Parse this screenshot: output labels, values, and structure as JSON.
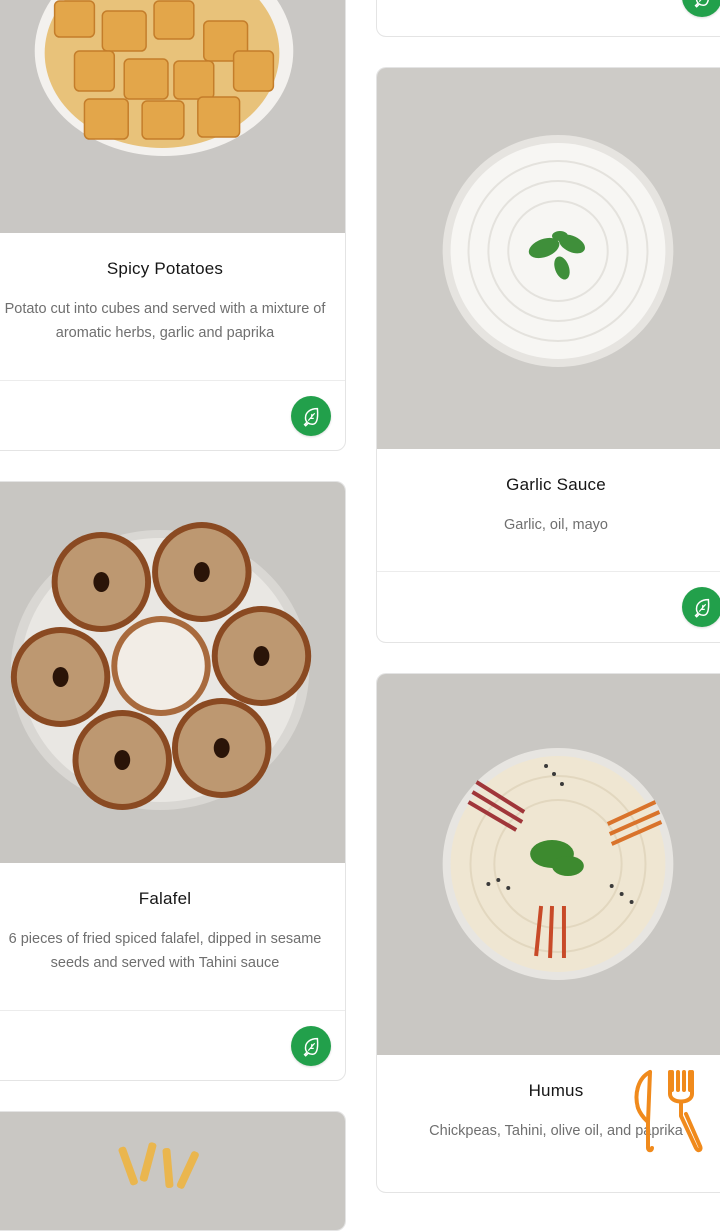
{
  "items": [
    {
      "title": "Spicy Potatoes",
      "description": "Potato cut into cubes and served with a mixture of aromatic herbs, garlic and paprika"
    },
    {
      "title": "Garlic Sauce",
      "description": "Garlic, oil, mayo"
    },
    {
      "title": "Falafel",
      "description": "6 pieces of fried spiced falafel, dipped in sesame seeds and served with Tahini sauce"
    },
    {
      "title": "Humus",
      "description": "Chickpeas, Tahini, olive oil, and paprika"
    }
  ],
  "icons": {
    "diet_badge": "leaf-icon",
    "floating_button": "fork-knife-icon"
  },
  "colors": {
    "accent_green": "#22a04b",
    "accent_orange": "#f08a1c"
  }
}
